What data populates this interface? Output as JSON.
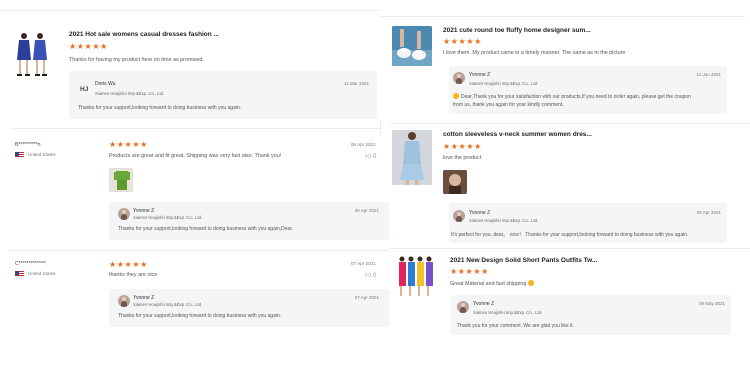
{
  "reviews_left": [
    {
      "product": "2021 Hot sale womens casual dresses fashion ...",
      "stars": "★★★★★",
      "comment": "Thanks for having my product here on time as promised.",
      "reply": {
        "initials": "HJ",
        "name": "Doris Wu",
        "company": "Xiamen Houjinfei Imp.&Exp. Co., Ltd.",
        "date": "11 Mar 2021",
        "text": "Thanks for your support,looking forward to doing business with you again."
      }
    },
    {
      "user": "B**********n",
      "country": "United States",
      "stars": "★★★★★",
      "comment": "Products are great and fit great. Shipping was very fast also. Thank you!",
      "date": "06 Apr 2021",
      "likes": "0",
      "reply": {
        "name": "Yvonne Z",
        "company": "Xiamen Houjinfei Imp.&Exp. Co., Ltd.",
        "date": "06 Apr 2021",
        "text": "Thanks for your support,looking forward to doing business with you again,Dear."
      }
    },
    {
      "user": "C**************",
      "country": "United States",
      "stars": "★★★★★",
      "comment": "thanks they are nice",
      "date": "07 Apr 2021",
      "likes": "0",
      "reply": {
        "name": "Yvonne Z",
        "company": "Xiamen Houjinfei Imp.&Exp. Co., Ltd.",
        "date": "07 Apr 2021",
        "text": "Thanks for your support,looking forward to doing business with you again."
      }
    }
  ],
  "reviews_right": [
    {
      "product": "2021 cute round toe fluffy home designer sum...",
      "stars": "★★★★★",
      "comment": "I love them. My product came in a timely manner. The same as in the picture",
      "reply": {
        "name": "Yvonne Z",
        "company": "Xiamen Houjinfei Imp.&Exp. Co., Ltd.",
        "date": "11 Jun 2021",
        "text1": "Dear,Thank you for your satisfaction with our products,If you need to order again, please get the coupon",
        "text2": "from us, thank you again for your kindly comment."
      }
    },
    {
      "product": "cotton sleeveless v-neck summer women dres...",
      "stars": "★★★★★",
      "comment": "love the product",
      "reply": {
        "name": "Yvonne Z",
        "company": "Xiamen Houjinfei Imp.&Exp. Co., Ltd.",
        "date": "08 Apr 2021",
        "text": "It's perfect for you, dear。 nice！ Thanks for your support,looking forward to doing business with you again."
      }
    },
    {
      "product": "2021 New Design Solid Short Pants Outfits Tw...",
      "stars": "★★★★★",
      "comment": "Great Material and fast shipping",
      "reply": {
        "name": "Yvonne Z",
        "company": "Xiamen Houjinfei Imp.&Exp. Co., Ltd.",
        "date": "09 May 2021",
        "text": "Thank you for your comment. We are glad you like it."
      }
    }
  ],
  "colors": {
    "star": "#f06a1d",
    "reply_bg": "#f4f5f6"
  },
  "icons": {
    "like": "thumbs-up-icon",
    "flag": "us-flag-icon"
  }
}
